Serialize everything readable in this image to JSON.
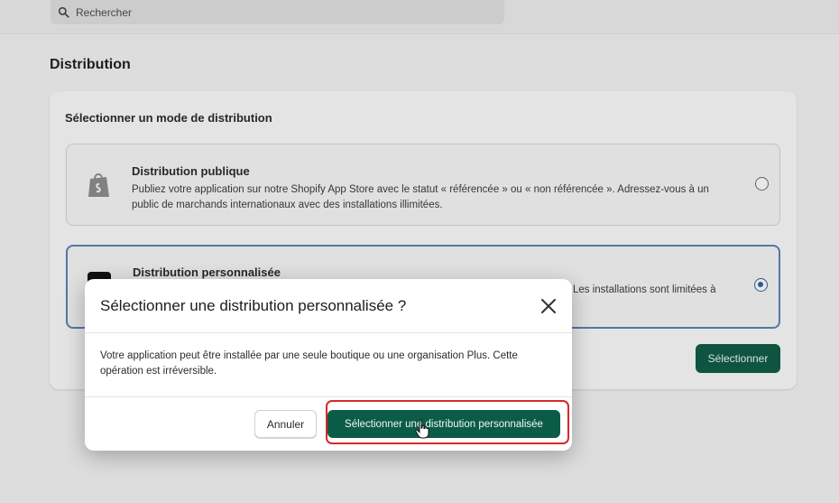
{
  "search": {
    "placeholder": "Rechercher",
    "icon": "search-icon"
  },
  "distribution": {
    "section_title": "Distribution",
    "card_heading": "Sélectionner un mode de distribution",
    "options": [
      {
        "title": "Distribution publique",
        "description": "Publiez votre application sur notre Shopify App Store avec le statut « référencée » ou « non référencée ». Adressez-vous à un public de marchands internationaux avec des installations illimitées.",
        "icon": "shopify-bag-icon",
        "selected": false
      },
      {
        "title": "Distribution personnalisée",
        "description_visible_tail": "Les installations sont limitées à",
        "icon": "custom-app-icon",
        "selected": true
      }
    ],
    "select_button": "Sélectionner"
  },
  "modal": {
    "title": "Sélectionner une distribution personnalisée ?",
    "body": "Votre application peut être installée par une seule boutique ou une organisation Plus. Cette opération est irréversible.",
    "cancel_label": "Annuler",
    "confirm_label": "Sélectionner une distribution personnalisée"
  },
  "colors": {
    "primary_button": "#0b5c47",
    "selected_border": "#5a7fb0",
    "highlight": "#d42a2a"
  }
}
